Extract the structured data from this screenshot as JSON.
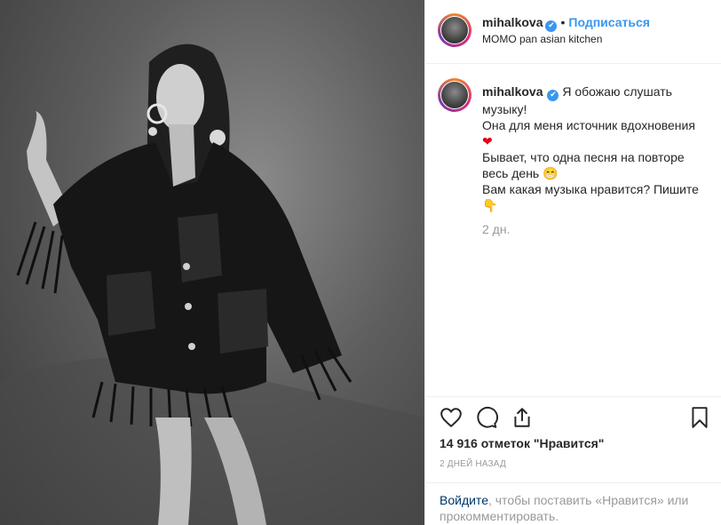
{
  "post": {
    "username": "mihalkova",
    "verified_icon": "✔",
    "separator": "•",
    "follow_label": "Подписаться",
    "location": "MOMO pan asian kitchen"
  },
  "caption": {
    "username": "mihalkova",
    "lines": [
      "Я обожаю слушать музыку!",
      "Она для меня источник вдохновения",
      "Бывает, что одна песня на повторе весь день",
      "Вам какая музыка нравится? Пишите"
    ],
    "emoji_heart": "❤",
    "emoji_grin": "😁",
    "emoji_point": "👇",
    "time": "2 дн."
  },
  "actions": {
    "likes": "14 916 отметок \"Нравится\"",
    "posted": "2 ДНЕЙ НАЗАД",
    "login_link": "Войдите",
    "login_text": ", чтобы поставить «Нравится» или прокомментировать."
  },
  "icons": [
    "heart-icon",
    "comment-icon",
    "share-icon",
    "bookmark-icon"
  ],
  "colors": {
    "link": "#3897f0",
    "muted": "#999999",
    "text": "#262626",
    "border": "#efefef"
  }
}
